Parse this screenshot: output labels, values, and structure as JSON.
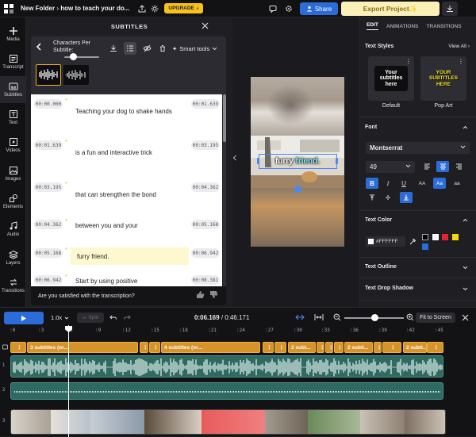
{
  "topbar": {
    "folder": "New Folder",
    "separator": "›",
    "project_name": "how to teach your do...",
    "upgrade_label": "UPGRADE",
    "share_label": "Share",
    "export_label": "Export Project"
  },
  "sidebar": {
    "items": [
      {
        "label": "Media",
        "icon": "plus-icon"
      },
      {
        "label": "Transcript",
        "icon": "transcript-icon"
      },
      {
        "label": "Subtitles",
        "icon": "subtitles-icon"
      },
      {
        "label": "Text",
        "icon": "text-icon"
      },
      {
        "label": "Videos",
        "icon": "video-icon"
      },
      {
        "label": "Images",
        "icon": "image-icon"
      },
      {
        "label": "Elements",
        "icon": "shapes-icon"
      },
      {
        "label": "Audio",
        "icon": "music-icon"
      },
      {
        "label": "Layers",
        "icon": "layers-icon"
      },
      {
        "label": "Transitions",
        "icon": "transitions-icon"
      }
    ]
  },
  "subtitles_panel": {
    "title": "SUBTITLES",
    "cps_label": "Characters Per Subtitle:",
    "cps_value_fraction": 0.2,
    "smart_tools_label": "Smart tools",
    "rows": [
      {
        "start": "00:00.000",
        "end": "00:01.639",
        "text": "Teaching your dog to shake hands"
      },
      {
        "start": "00:01.639",
        "end": "00:03.195",
        "text": "is a fun and interactive trick"
      },
      {
        "start": "00:03.195",
        "end": "00:04.362",
        "text": "that can strengthen the bond"
      },
      {
        "start": "00:04.362",
        "end": "00:05.168",
        "text": "between you and your"
      },
      {
        "start": "00:05.168",
        "end": "00:06.942",
        "text": "furry friend."
      },
      {
        "start": "00:06.942",
        "end": "00:08.381",
        "text": "Start by using positive"
      }
    ],
    "satisfied_prompt": "Are you satisfied with the transcription?"
  },
  "canvas": {
    "caption_plain": "furry ",
    "caption_highlight": "friend."
  },
  "right_panel": {
    "tabs": [
      "EDIT",
      "ANIMATIONS",
      "TRANSITIONS"
    ],
    "text_styles_label": "Text Styles",
    "view_all_label": "View All",
    "styles": [
      {
        "name": "Default",
        "preview": "Your subtitles here"
      },
      {
        "name": "Pop Art",
        "preview": "YOUR SUBTITLES HERE"
      }
    ],
    "font_label": "Font",
    "font_family": "Montserrat",
    "font_size": "49",
    "text_color_label": "Text Color",
    "text_color_hex": "#FFFFFF",
    "swatches": [
      "#000000",
      "#ffffff",
      "#e8212f",
      "#f5d90a",
      "#2b6cd9"
    ],
    "text_outline_label": "Text Outline",
    "text_shadow_label": "Text Drop Shadow"
  },
  "timeline": {
    "speed": "1.0x",
    "split_label": "Split",
    "current_time": "0:06.169",
    "total_time": "0:46.171",
    "fit_label": "Fit to Screen",
    "ruler_ticks": [
      ":0",
      ":3",
      ":6",
      ":9",
      ":12",
      ":15",
      ":18",
      ":21",
      ":24",
      ":27",
      ":30",
      ":33",
      ":36",
      ":39",
      ":42",
      ":45"
    ],
    "track_numbers": [
      "1",
      "2",
      "3"
    ],
    "subtitle_clips": [
      "3 subtitles (or...",
      "4 subtitles (or...",
      "2 subt...",
      "2 subti...",
      "2 subti..."
    ],
    "zoom_fraction": 0.5
  },
  "colors": {
    "accent": "#2b6cd9",
    "upgrade": "#f7c21b",
    "export_bg": "#fbf0b8",
    "subtitle_clip": "#d5932a",
    "audio_clip": "#2f6a62"
  }
}
